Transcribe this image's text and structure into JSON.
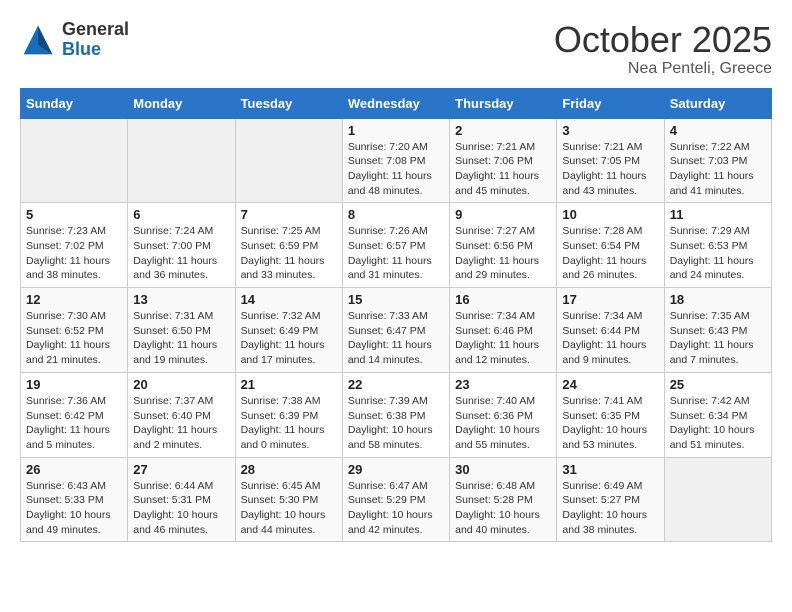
{
  "header": {
    "logo_general": "General",
    "logo_blue": "Blue",
    "month_year": "October 2025",
    "location": "Nea Penteli, Greece"
  },
  "days_of_week": [
    "Sunday",
    "Monday",
    "Tuesday",
    "Wednesday",
    "Thursday",
    "Friday",
    "Saturday"
  ],
  "weeks": [
    [
      {
        "num": "",
        "info": ""
      },
      {
        "num": "",
        "info": ""
      },
      {
        "num": "",
        "info": ""
      },
      {
        "num": "1",
        "info": "Sunrise: 7:20 AM\nSunset: 7:08 PM\nDaylight: 11 hours\nand 48 minutes."
      },
      {
        "num": "2",
        "info": "Sunrise: 7:21 AM\nSunset: 7:06 PM\nDaylight: 11 hours\nand 45 minutes."
      },
      {
        "num": "3",
        "info": "Sunrise: 7:21 AM\nSunset: 7:05 PM\nDaylight: 11 hours\nand 43 minutes."
      },
      {
        "num": "4",
        "info": "Sunrise: 7:22 AM\nSunset: 7:03 PM\nDaylight: 11 hours\nand 41 minutes."
      }
    ],
    [
      {
        "num": "5",
        "info": "Sunrise: 7:23 AM\nSunset: 7:02 PM\nDaylight: 11 hours\nand 38 minutes."
      },
      {
        "num": "6",
        "info": "Sunrise: 7:24 AM\nSunset: 7:00 PM\nDaylight: 11 hours\nand 36 minutes."
      },
      {
        "num": "7",
        "info": "Sunrise: 7:25 AM\nSunset: 6:59 PM\nDaylight: 11 hours\nand 33 minutes."
      },
      {
        "num": "8",
        "info": "Sunrise: 7:26 AM\nSunset: 6:57 PM\nDaylight: 11 hours\nand 31 minutes."
      },
      {
        "num": "9",
        "info": "Sunrise: 7:27 AM\nSunset: 6:56 PM\nDaylight: 11 hours\nand 29 minutes."
      },
      {
        "num": "10",
        "info": "Sunrise: 7:28 AM\nSunset: 6:54 PM\nDaylight: 11 hours\nand 26 minutes."
      },
      {
        "num": "11",
        "info": "Sunrise: 7:29 AM\nSunset: 6:53 PM\nDaylight: 11 hours\nand 24 minutes."
      }
    ],
    [
      {
        "num": "12",
        "info": "Sunrise: 7:30 AM\nSunset: 6:52 PM\nDaylight: 11 hours\nand 21 minutes."
      },
      {
        "num": "13",
        "info": "Sunrise: 7:31 AM\nSunset: 6:50 PM\nDaylight: 11 hours\nand 19 minutes."
      },
      {
        "num": "14",
        "info": "Sunrise: 7:32 AM\nSunset: 6:49 PM\nDaylight: 11 hours\nand 17 minutes."
      },
      {
        "num": "15",
        "info": "Sunrise: 7:33 AM\nSunset: 6:47 PM\nDaylight: 11 hours\nand 14 minutes."
      },
      {
        "num": "16",
        "info": "Sunrise: 7:34 AM\nSunset: 6:46 PM\nDaylight: 11 hours\nand 12 minutes."
      },
      {
        "num": "17",
        "info": "Sunrise: 7:34 AM\nSunset: 6:44 PM\nDaylight: 11 hours\nand 9 minutes."
      },
      {
        "num": "18",
        "info": "Sunrise: 7:35 AM\nSunset: 6:43 PM\nDaylight: 11 hours\nand 7 minutes."
      }
    ],
    [
      {
        "num": "19",
        "info": "Sunrise: 7:36 AM\nSunset: 6:42 PM\nDaylight: 11 hours\nand 5 minutes."
      },
      {
        "num": "20",
        "info": "Sunrise: 7:37 AM\nSunset: 6:40 PM\nDaylight: 11 hours\nand 2 minutes."
      },
      {
        "num": "21",
        "info": "Sunrise: 7:38 AM\nSunset: 6:39 PM\nDaylight: 11 hours\nand 0 minutes."
      },
      {
        "num": "22",
        "info": "Sunrise: 7:39 AM\nSunset: 6:38 PM\nDaylight: 10 hours\nand 58 minutes."
      },
      {
        "num": "23",
        "info": "Sunrise: 7:40 AM\nSunset: 6:36 PM\nDaylight: 10 hours\nand 55 minutes."
      },
      {
        "num": "24",
        "info": "Sunrise: 7:41 AM\nSunset: 6:35 PM\nDaylight: 10 hours\nand 53 minutes."
      },
      {
        "num": "25",
        "info": "Sunrise: 7:42 AM\nSunset: 6:34 PM\nDaylight: 10 hours\nand 51 minutes."
      }
    ],
    [
      {
        "num": "26",
        "info": "Sunrise: 6:43 AM\nSunset: 5:33 PM\nDaylight: 10 hours\nand 49 minutes."
      },
      {
        "num": "27",
        "info": "Sunrise: 6:44 AM\nSunset: 5:31 PM\nDaylight: 10 hours\nand 46 minutes."
      },
      {
        "num": "28",
        "info": "Sunrise: 6:45 AM\nSunset: 5:30 PM\nDaylight: 10 hours\nand 44 minutes."
      },
      {
        "num": "29",
        "info": "Sunrise: 6:47 AM\nSunset: 5:29 PM\nDaylight: 10 hours\nand 42 minutes."
      },
      {
        "num": "30",
        "info": "Sunrise: 6:48 AM\nSunset: 5:28 PM\nDaylight: 10 hours\nand 40 minutes."
      },
      {
        "num": "31",
        "info": "Sunrise: 6:49 AM\nSunset: 5:27 PM\nDaylight: 10 hours\nand 38 minutes."
      },
      {
        "num": "",
        "info": ""
      }
    ]
  ]
}
